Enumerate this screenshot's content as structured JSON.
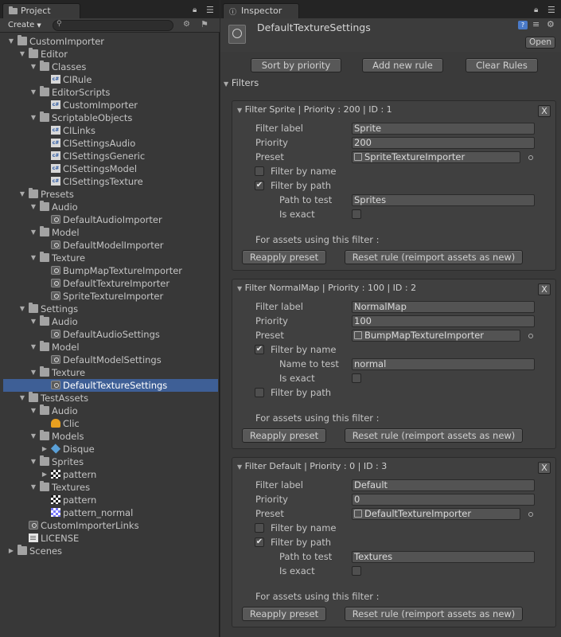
{
  "project": {
    "tab_label": "Project",
    "create_label": "Create",
    "tree": [
      {
        "depth": 0,
        "arrow": "down",
        "icon": "folder",
        "label": "CustomImporter"
      },
      {
        "depth": 1,
        "arrow": "down",
        "icon": "folder",
        "label": "Editor"
      },
      {
        "depth": 2,
        "arrow": "down",
        "icon": "folder",
        "label": "Classes"
      },
      {
        "depth": 3,
        "arrow": "",
        "icon": "cs",
        "label": "CIRule"
      },
      {
        "depth": 2,
        "arrow": "down",
        "icon": "folder",
        "label": "EditorScripts"
      },
      {
        "depth": 3,
        "arrow": "",
        "icon": "cs",
        "label": "CustomImporter"
      },
      {
        "depth": 2,
        "arrow": "down",
        "icon": "folder",
        "label": "ScriptableObjects"
      },
      {
        "depth": 3,
        "arrow": "",
        "icon": "cs",
        "label": "CILinks"
      },
      {
        "depth": 3,
        "arrow": "",
        "icon": "cs",
        "label": "CISettingsAudio"
      },
      {
        "depth": 3,
        "arrow": "",
        "icon": "cs",
        "label": "CISettingsGeneric"
      },
      {
        "depth": 3,
        "arrow": "",
        "icon": "cs",
        "label": "CISettingsModel"
      },
      {
        "depth": 3,
        "arrow": "",
        "icon": "cs",
        "label": "CISettingsTexture"
      },
      {
        "depth": 1,
        "arrow": "down",
        "icon": "folder",
        "label": "Presets"
      },
      {
        "depth": 2,
        "arrow": "down",
        "icon": "folder",
        "label": "Audio"
      },
      {
        "depth": 3,
        "arrow": "",
        "icon": "asset",
        "label": "DefaultAudioImporter"
      },
      {
        "depth": 2,
        "arrow": "down",
        "icon": "folder",
        "label": "Model"
      },
      {
        "depth": 3,
        "arrow": "",
        "icon": "asset",
        "label": "DefaultModelImporter"
      },
      {
        "depth": 2,
        "arrow": "down",
        "icon": "folder",
        "label": "Texture"
      },
      {
        "depth": 3,
        "arrow": "",
        "icon": "asset",
        "label": "BumpMapTextureImporter"
      },
      {
        "depth": 3,
        "arrow": "",
        "icon": "asset",
        "label": "DefaultTextureImporter"
      },
      {
        "depth": 3,
        "arrow": "",
        "icon": "asset",
        "label": "SpriteTextureImporter"
      },
      {
        "depth": 1,
        "arrow": "down",
        "icon": "folder",
        "label": "Settings"
      },
      {
        "depth": 2,
        "arrow": "down",
        "icon": "folder",
        "label": "Audio"
      },
      {
        "depth": 3,
        "arrow": "",
        "icon": "asset",
        "label": "DefaultAudioSettings"
      },
      {
        "depth": 2,
        "arrow": "down",
        "icon": "folder",
        "label": "Model"
      },
      {
        "depth": 3,
        "arrow": "",
        "icon": "asset",
        "label": "DefaultModelSettings"
      },
      {
        "depth": 2,
        "arrow": "down",
        "icon": "folder",
        "label": "Texture"
      },
      {
        "depth": 3,
        "arrow": "",
        "icon": "asset",
        "label": "DefaultTextureSettings",
        "selected": true
      },
      {
        "depth": 1,
        "arrow": "down",
        "icon": "folder",
        "label": "TestAssets"
      },
      {
        "depth": 2,
        "arrow": "down",
        "icon": "folder",
        "label": "Audio"
      },
      {
        "depth": 3,
        "arrow": "",
        "icon": "audio",
        "label": "Clic"
      },
      {
        "depth": 2,
        "arrow": "down",
        "icon": "folder",
        "label": "Models"
      },
      {
        "depth": 3,
        "arrow": "right",
        "icon": "cube",
        "label": "Disque"
      },
      {
        "depth": 2,
        "arrow": "down",
        "icon": "folder",
        "label": "Sprites"
      },
      {
        "depth": 3,
        "arrow": "right",
        "icon": "tex",
        "label": "pattern"
      },
      {
        "depth": 2,
        "arrow": "down",
        "icon": "folder",
        "label": "Textures"
      },
      {
        "depth": 3,
        "arrow": "",
        "icon": "tex",
        "label": "pattern"
      },
      {
        "depth": 3,
        "arrow": "",
        "icon": "texn",
        "label": "pattern_normal"
      },
      {
        "depth": 1,
        "arrow": "",
        "icon": "asset",
        "label": "CustomImporterLinks"
      },
      {
        "depth": 1,
        "arrow": "",
        "icon": "doc",
        "label": "LICENSE"
      },
      {
        "depth": 0,
        "arrow": "right",
        "icon": "folder",
        "label": "Scenes"
      }
    ]
  },
  "inspector": {
    "tab_label": "Inspector",
    "object_title": "DefaultTextureSettings",
    "open_label": "Open",
    "sort_label": "Sort by priority",
    "add_label": "Add new rule",
    "clear_label": "Clear Rules",
    "filters_label": "Filters",
    "labels": {
      "filter_label": "Filter label",
      "priority": "Priority",
      "preset": "Preset",
      "filter_by_name": "Filter by name",
      "filter_by_path": "Filter by path",
      "is_exact": "Is exact",
      "for_assets": "For assets using this filter :",
      "reapply": "Reapply preset",
      "reset": "Reset rule (reimport assets as new)",
      "close": "X"
    },
    "filters": [
      {
        "header": "Filter Sprite | Priority : 200 | ID : 1",
        "label": "Sprite",
        "priority": "200",
        "preset": "SpriteTextureImporter",
        "by_name": false,
        "by_path": true,
        "sub_label": "Path to test",
        "sub_value": "Sprites"
      },
      {
        "header": "Filter NormalMap | Priority : 100 | ID : 2",
        "label": "NormalMap",
        "priority": "100",
        "preset": "BumpMapTextureImporter",
        "by_name": true,
        "by_path": false,
        "sub_label": "Name to test",
        "sub_value": "normal"
      },
      {
        "header": "Filter Default | Priority : 0 | ID : 3",
        "label": "Default",
        "priority": "0",
        "preset": "DefaultTextureImporter",
        "by_name": false,
        "by_path": true,
        "sub_label": "Path to test",
        "sub_value": "Textures"
      }
    ]
  }
}
